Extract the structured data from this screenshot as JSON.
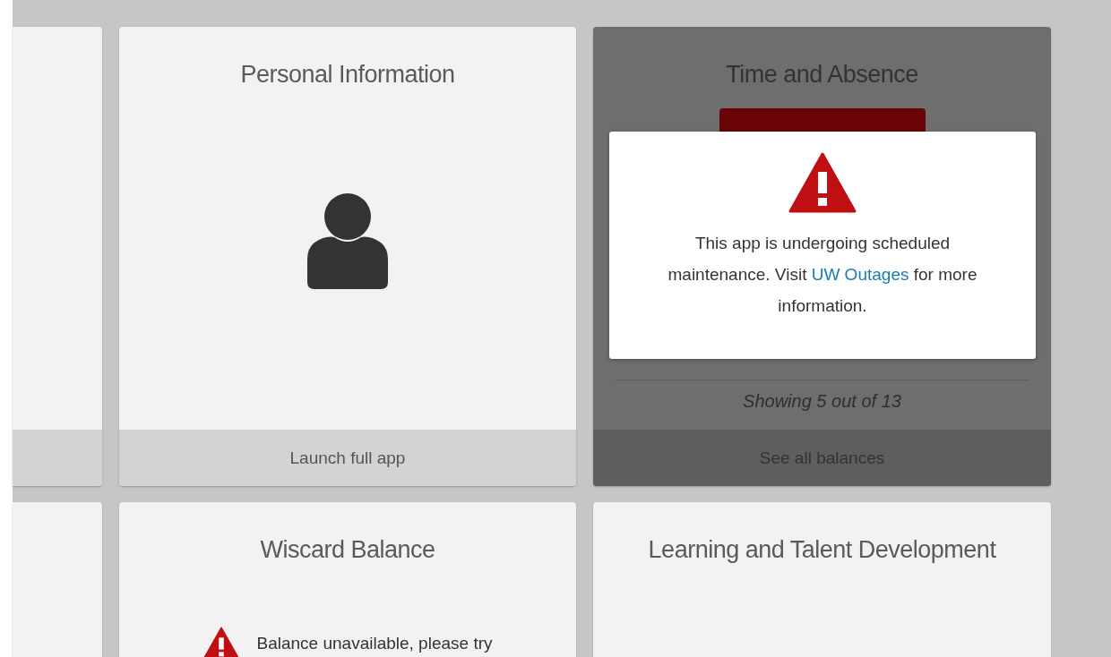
{
  "cards": [
    {
      "kind": "blank",
      "disabled": false
    },
    {
      "kind": "person",
      "title": "Personal Information",
      "footer": "Launch full app",
      "disabled": false
    },
    {
      "kind": "balances",
      "title": "Time and Absence",
      "summary": "Showing 5 out of 13",
      "footer": "See all balances",
      "disabled": true,
      "notice": {
        "before": "This app is undergoing scheduled maintenance. Visit ",
        "link": "UW Outages",
        "after": " for more information."
      }
    },
    {
      "kind": "blank",
      "disabled": false
    },
    {
      "kind": "alert",
      "title": "Wiscard Balance",
      "message": "Balance unavailable, please try",
      "disabled": false
    },
    {
      "kind": "plain",
      "title": "Learning and Talent Development",
      "disabled": false
    }
  ]
}
